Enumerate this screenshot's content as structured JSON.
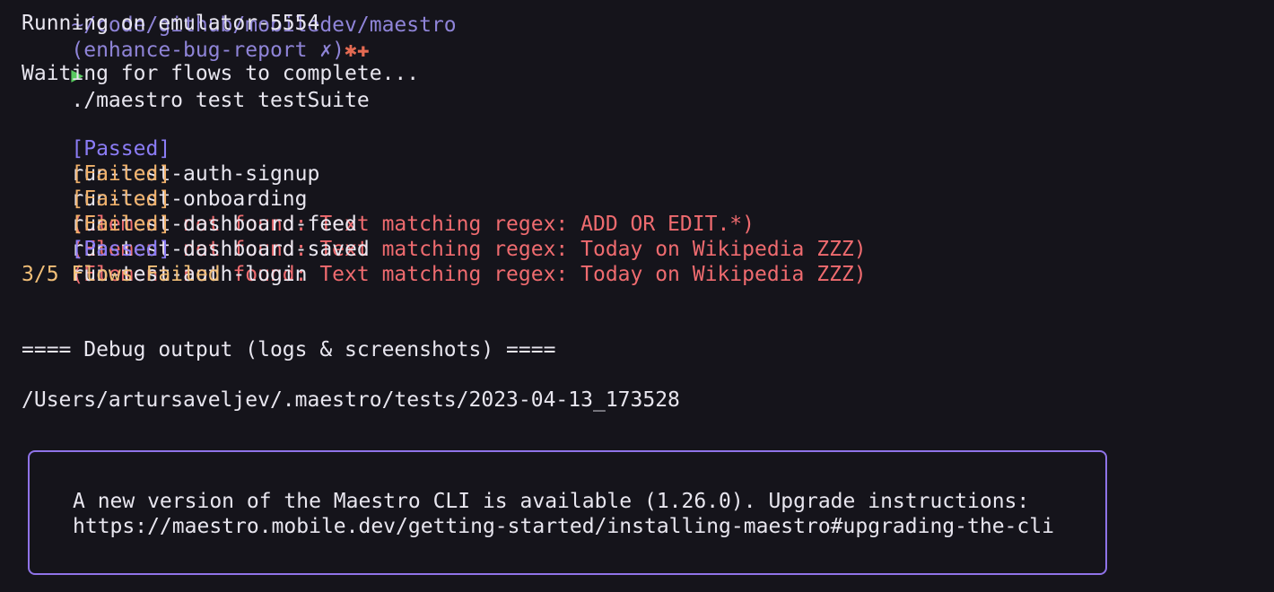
{
  "prompt": {
    "path": "~/code/github/mobiledev/maestro",
    "branch": "(enhance-bug-report ✗)",
    "markers": "✱✚",
    "arrow": "▶",
    "command": "./maestro test testSuite"
  },
  "output": {
    "running": "Running on emulator-5554",
    "waiting": "Waiting for flows to complete...",
    "flows": [
      {
        "status": "[Passed]",
        "name": "run-test-auth-signup",
        "message": ""
      },
      {
        "status": "[Failed]",
        "name": "run-test-onboarding",
        "message": "(Element not found: Text matching regex: ADD OR EDIT.*)"
      },
      {
        "status": "[Failed]",
        "name": "run-test-dashboard-feed",
        "message": "(Element not found: Text matching regex: Today on Wikipedia ZZZ)"
      },
      {
        "status": "[Failed]",
        "name": "run-test-dashboard-saved",
        "message": "(Element not found: Text matching regex: Today on Wikipedia ZZZ)"
      },
      {
        "status": "[Passed]",
        "name": "run-test-auth-login",
        "message": ""
      }
    ],
    "summary": "3/5 Flows Failed",
    "debug_heading": "==== Debug output (logs & screenshots) ====",
    "debug_path": "/Users/artursaveljev/.maestro/tests/2023-04-13_173528"
  },
  "update_notice": {
    "line1": "A new version of the Maestro CLI is available (1.26.0). Upgrade instructions:",
    "line2": "https://maestro.mobile.dev/getting-started/installing-maestro#upgrading-the-cli"
  },
  "colors": {
    "background": "#15141b",
    "text": "#e8e6ef",
    "passed": "#8b7cf5",
    "failed": "#f0b16b",
    "error": "#ef6b6f",
    "summary": "#f2bf78",
    "box_border": "#8f73e8"
  }
}
